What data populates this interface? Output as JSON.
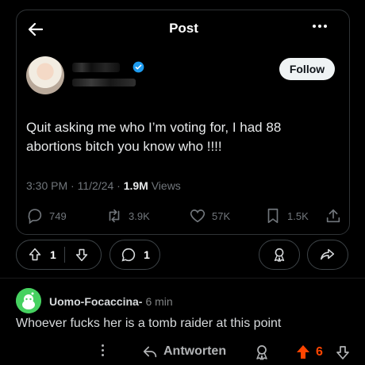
{
  "tweet": {
    "header_title": "Post",
    "follow_label": "Follow",
    "text": "Quit asking me who I’m voting for, I had 88\nabortions bitch you know who !!!!",
    "time": "3:30 PM · 11/2/24 · ",
    "views_count": "1.9M",
    "views_label": " Views",
    "replies": "749",
    "reposts": "3.9K",
    "likes": "57K",
    "bookmarks": "1.5K",
    "verified_color": "#1d9bf0"
  },
  "post_bar": {
    "votes": "1",
    "comments": "1"
  },
  "comment": {
    "author": "Uomo-Focaccina-",
    "time": "6 min",
    "body": "Whoever fucks her is a tomb raider at this point",
    "reply_label": "Antworten",
    "score": "6",
    "upvote_color": "#ff4500"
  },
  "icons": [
    "back-arrow-icon",
    "more-icon",
    "verified-icon",
    "reply-icon",
    "repost-icon",
    "like-icon",
    "bookmark-icon",
    "share-icon",
    "upvote-icon",
    "downvote-icon",
    "comment-icon",
    "award-icon",
    "reddit-avatar-icon"
  ]
}
